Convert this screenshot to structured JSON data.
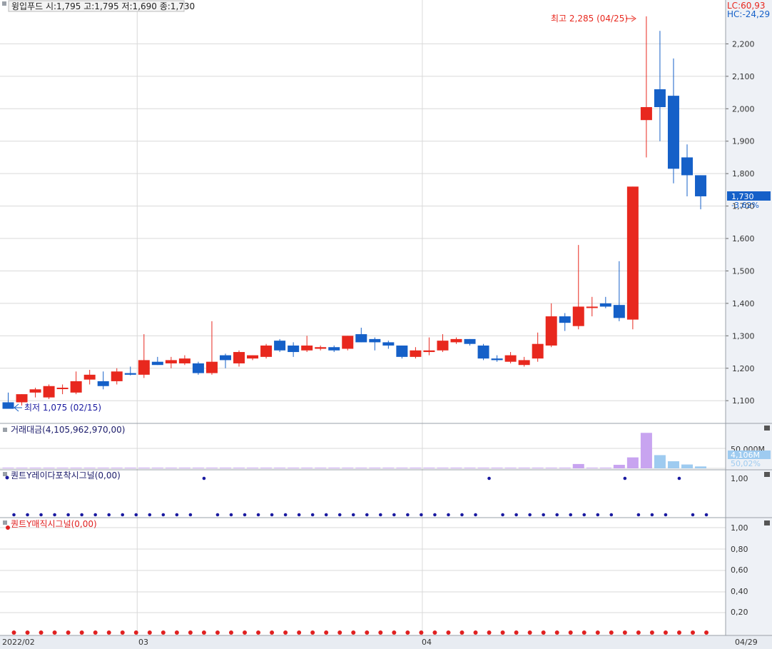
{
  "header": {
    "title": "윙입푸드 시:1,795 고:1,795 저:1,690 종:1,730",
    "lc": "LC:60,93",
    "hc": "HC:-24,29"
  },
  "price_badge": {
    "price": "1,730",
    "change": "-3,62%"
  },
  "annotations": {
    "high": "최고 2,285 (04/25)",
    "low": "최저 1,075 (02/15)"
  },
  "panels": {
    "volume": {
      "title": "거래대금(4,105,962,970,00)",
      "scale_label": "50,000M",
      "value_badge": "4,106M",
      "pct": "50,02%"
    },
    "radar": {
      "title": "퀀트Y레이다포착시그널(0,00)",
      "tick": "1,00"
    },
    "magic": {
      "title": "퀀트Y매직시그널(0,00)",
      "ticks": [
        "1,00",
        "0,80",
        "0,60",
        "0,40",
        "0,20"
      ]
    }
  },
  "x_axis": {
    "labels": [
      "2022/02",
      "03",
      "04",
      "04/29"
    ]
  },
  "colors": {
    "up": "#e8281e",
    "down": "#1560c8",
    "grid": "#d9d9d9",
    "axis_text": "#333333",
    "volume": "#c8a4f0",
    "volume_recent": "#9ecbf0",
    "signal_blue": "#1a1aa0",
    "signal_red": "#e02020"
  },
  "chart_data": {
    "type": "candlestick",
    "title": "윙입푸드",
    "ylim": [
      1030,
      2300
    ],
    "y_ticks": [
      1100,
      1200,
      1300,
      1400,
      1500,
      1600,
      1700,
      1800,
      1900,
      2000,
      2100,
      2200
    ],
    "y_tick_labels": [
      "1,100",
      "1,200",
      "1,300",
      "1,400",
      "1,500",
      "1,600",
      "1,700",
      "1,800",
      "1,900",
      "2,000",
      "2,100",
      "2,200"
    ],
    "candles": [
      {
        "o": 1095,
        "h": 1125,
        "l": 1075,
        "c": 1075
      },
      {
        "o": 1095,
        "h": 1120,
        "l": 1085,
        "c": 1120
      },
      {
        "o": 1125,
        "h": 1140,
        "l": 1110,
        "c": 1135
      },
      {
        "o": 1110,
        "h": 1150,
        "l": 1105,
        "c": 1145
      },
      {
        "o": 1140,
        "h": 1150,
        "l": 1120,
        "c": 1140
      },
      {
        "o": 1125,
        "h": 1190,
        "l": 1120,
        "c": 1160
      },
      {
        "o": 1165,
        "h": 1195,
        "l": 1150,
        "c": 1180
      },
      {
        "o": 1160,
        "h": 1190,
        "l": 1135,
        "c": 1145
      },
      {
        "o": 1160,
        "h": 1200,
        "l": 1150,
        "c": 1190
      },
      {
        "o": 1185,
        "h": 1205,
        "l": 1178,
        "c": 1180
      },
      {
        "o": 1180,
        "h": 1305,
        "l": 1170,
        "c": 1225
      },
      {
        "o": 1220,
        "h": 1235,
        "l": 1210,
        "c": 1210
      },
      {
        "o": 1215,
        "h": 1235,
        "l": 1200,
        "c": 1225
      },
      {
        "o": 1215,
        "h": 1240,
        "l": 1210,
        "c": 1230
      },
      {
        "o": 1215,
        "h": 1220,
        "l": 1180,
        "c": 1185
      },
      {
        "o": 1185,
        "h": 1345,
        "l": 1180,
        "c": 1220
      },
      {
        "o": 1240,
        "h": 1245,
        "l": 1200,
        "c": 1225
      },
      {
        "o": 1215,
        "h": 1255,
        "l": 1205,
        "c": 1250
      },
      {
        "o": 1230,
        "h": 1240,
        "l": 1225,
        "c": 1240
      },
      {
        "o": 1235,
        "h": 1275,
        "l": 1230,
        "c": 1270
      },
      {
        "o": 1285,
        "h": 1290,
        "l": 1250,
        "c": 1255
      },
      {
        "o": 1270,
        "h": 1280,
        "l": 1235,
        "c": 1250
      },
      {
        "o": 1255,
        "h": 1300,
        "l": 1250,
        "c": 1270
      },
      {
        "o": 1260,
        "h": 1270,
        "l": 1255,
        "c": 1265
      },
      {
        "o": 1265,
        "h": 1270,
        "l": 1250,
        "c": 1255
      },
      {
        "o": 1260,
        "h": 1300,
        "l": 1255,
        "c": 1300
      },
      {
        "o": 1305,
        "h": 1325,
        "l": 1280,
        "c": 1280
      },
      {
        "o": 1290,
        "h": 1295,
        "l": 1255,
        "c": 1280
      },
      {
        "o": 1280,
        "h": 1285,
        "l": 1260,
        "c": 1270
      },
      {
        "o": 1270,
        "h": 1270,
        "l": 1230,
        "c": 1235
      },
      {
        "o": 1235,
        "h": 1265,
        "l": 1230,
        "c": 1255
      },
      {
        "o": 1250,
        "h": 1295,
        "l": 1240,
        "c": 1255
      },
      {
        "o": 1255,
        "h": 1305,
        "l": 1250,
        "c": 1285
      },
      {
        "o": 1280,
        "h": 1295,
        "l": 1275,
        "c": 1290
      },
      {
        "o": 1290,
        "h": 1290,
        "l": 1270,
        "c": 1275
      },
      {
        "o": 1270,
        "h": 1275,
        "l": 1225,
        "c": 1230
      },
      {
        "o": 1230,
        "h": 1240,
        "l": 1220,
        "c": 1225
      },
      {
        "o": 1220,
        "h": 1250,
        "l": 1215,
        "c": 1240
      },
      {
        "o": 1210,
        "h": 1235,
        "l": 1205,
        "c": 1225
      },
      {
        "o": 1230,
        "h": 1310,
        "l": 1220,
        "c": 1275
      },
      {
        "o": 1270,
        "h": 1400,
        "l": 1265,
        "c": 1360
      },
      {
        "o": 1360,
        "h": 1370,
        "l": 1315,
        "c": 1340
      },
      {
        "o": 1330,
        "h": 1580,
        "l": 1320,
        "c": 1390
      },
      {
        "o": 1390,
        "h": 1420,
        "l": 1360,
        "c": 1390
      },
      {
        "o": 1400,
        "h": 1420,
        "l": 1385,
        "c": 1390
      },
      {
        "o": 1395,
        "h": 1530,
        "l": 1345,
        "c": 1355
      },
      {
        "o": 1350,
        "h": 1760,
        "l": 1320,
        "c": 1760
      },
      {
        "o": 1965,
        "h": 2285,
        "l": 1850,
        "c": 2005
      },
      {
        "o": 2060,
        "h": 2240,
        "l": 1900,
        "c": 2005
      },
      {
        "o": 2040,
        "h": 2155,
        "l": 1770,
        "c": 1815
      },
      {
        "o": 1850,
        "h": 1890,
        "l": 1730,
        "c": 1795
      },
      {
        "o": 1795,
        "h": 1795,
        "l": 1690,
        "c": 1730
      }
    ],
    "volume": [
      0,
      0,
      0,
      0,
      0,
      0,
      0,
      0,
      0,
      0,
      60,
      0,
      0,
      0,
      0,
      50,
      0,
      0,
      0,
      0,
      0,
      0,
      0,
      0,
      0,
      0,
      0,
      0,
      0,
      0,
      0,
      0,
      0,
      0,
      0,
      0,
      0,
      0,
      0,
      0,
      40,
      0,
      1350,
      0,
      0,
      1100,
      3400,
      11000,
      4100,
      2200,
      1200,
      600
    ],
    "volume_ylim": [
      0,
      11500
    ],
    "radar_signals": [
      1,
      1,
      1,
      1,
      1,
      1,
      1,
      1,
      1,
      1,
      1,
      1,
      1,
      1,
      0,
      1,
      1,
      1,
      1,
      1,
      1,
      1,
      1,
      1,
      1,
      1,
      1,
      1,
      1,
      1,
      1,
      1,
      1,
      1,
      1,
      0,
      1,
      1,
      1,
      1,
      1,
      1,
      1,
      1,
      1,
      0,
      1,
      1,
      1,
      0,
      1,
      1
    ],
    "magic_signals": [
      1,
      1,
      1,
      1,
      1,
      1,
      1,
      1,
      1,
      1,
      1,
      1,
      1,
      1,
      1,
      1,
      1,
      1,
      1,
      1,
      1,
      1,
      1,
      1,
      1,
      1,
      1,
      1,
      1,
      1,
      1,
      1,
      1,
      1,
      1,
      1,
      1,
      1,
      1,
      1,
      1,
      1,
      1,
      1,
      1,
      1,
      1,
      1,
      1,
      1,
      1,
      1
    ]
  }
}
